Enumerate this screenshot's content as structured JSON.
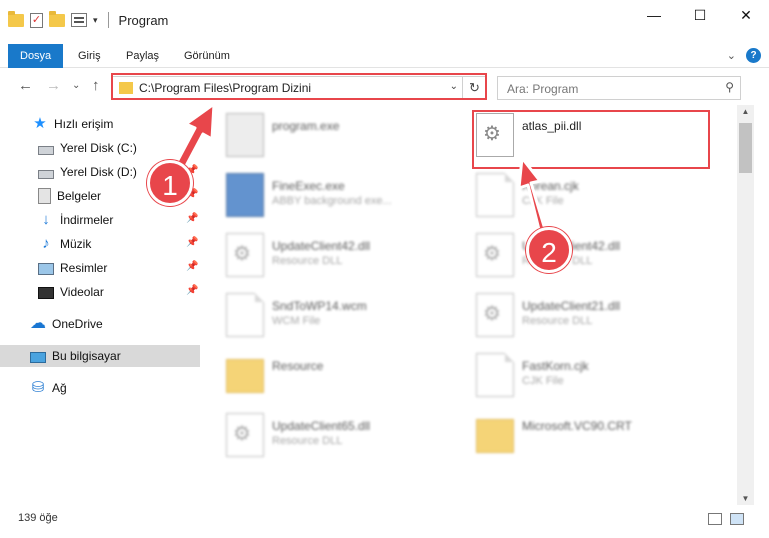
{
  "window": {
    "title": "Program",
    "controls": {
      "minimize": "—",
      "maximize": "☐",
      "close": "✕"
    }
  },
  "ribbon": {
    "tabs": [
      {
        "label": "Dosya",
        "active": true
      },
      {
        "label": "Giriş"
      },
      {
        "label": "Paylaş"
      },
      {
        "label": "Görünüm"
      }
    ],
    "help_label": "?"
  },
  "nav": {
    "back_icon": "←",
    "forward_icon": "→",
    "recent_icon": "⌄",
    "up_icon": "↑",
    "address": "C:\\Program Files\\Program Dizini",
    "dropdown_icon": "⌄",
    "refresh_icon": "↻",
    "search_placeholder": "Ara: Program",
    "search_icon": "⚲"
  },
  "sidebar": {
    "quick_access": "Hızlı erişim",
    "items": [
      {
        "label": "Yerel Disk (C:)",
        "icon": "drive-icon"
      },
      {
        "label": "Yerel Disk (D:)",
        "icon": "drive-icon"
      },
      {
        "label": "Belgeler",
        "icon": "documents-icon"
      },
      {
        "label": "İndirmeler",
        "icon": "downloads-icon"
      },
      {
        "label": "Müzik",
        "icon": "music-icon"
      },
      {
        "label": "Resimler",
        "icon": "pictures-icon"
      },
      {
        "label": "Videolar",
        "icon": "videos-icon"
      }
    ],
    "onedrive": "OneDrive",
    "this_pc": "Bu bilgisayar",
    "network": "Ağ",
    "pin_icon": "📌"
  },
  "files": [
    {
      "name": "program.exe",
      "type": "",
      "icon": "setup-icon"
    },
    {
      "name": "atlas_pii.dll",
      "type": "",
      "icon": "dll-gear-icon"
    },
    {
      "name": "FineExec.exe",
      "type": "ABBY background exe...",
      "icon": "exe-icon"
    },
    {
      "name": "Korean.cjk",
      "type": "CJK File",
      "icon": "page-icon"
    },
    {
      "name": "UpdateClient42.dll",
      "type": "Resource DLL",
      "icon": "dll-gear-icon"
    },
    {
      "name": "UpdateClient42.dll",
      "type": "Resource DLL",
      "icon": "dll-gear-icon"
    },
    {
      "name": "SndToWP14.wcm",
      "type": "WCM File",
      "icon": "page-icon"
    },
    {
      "name": "UpdateClient21.dll",
      "type": "Resource DLL",
      "icon": "dll-gear-icon"
    },
    {
      "name": "Resource",
      "type": "",
      "icon": "folder-icon"
    },
    {
      "name": "FastKorn.cjk",
      "type": "CJK File",
      "icon": "page-icon"
    },
    {
      "name": "UpdateClient65.dll",
      "type": "Resource DLL",
      "icon": "dll-gear-icon"
    },
    {
      "name": "Microsoft.VC90.CRT",
      "type": "",
      "icon": "folder-icon"
    }
  ],
  "status": {
    "count": "139 öğe"
  },
  "annotations": {
    "step1": "1",
    "step2": "2",
    "color": "#e8464b"
  }
}
